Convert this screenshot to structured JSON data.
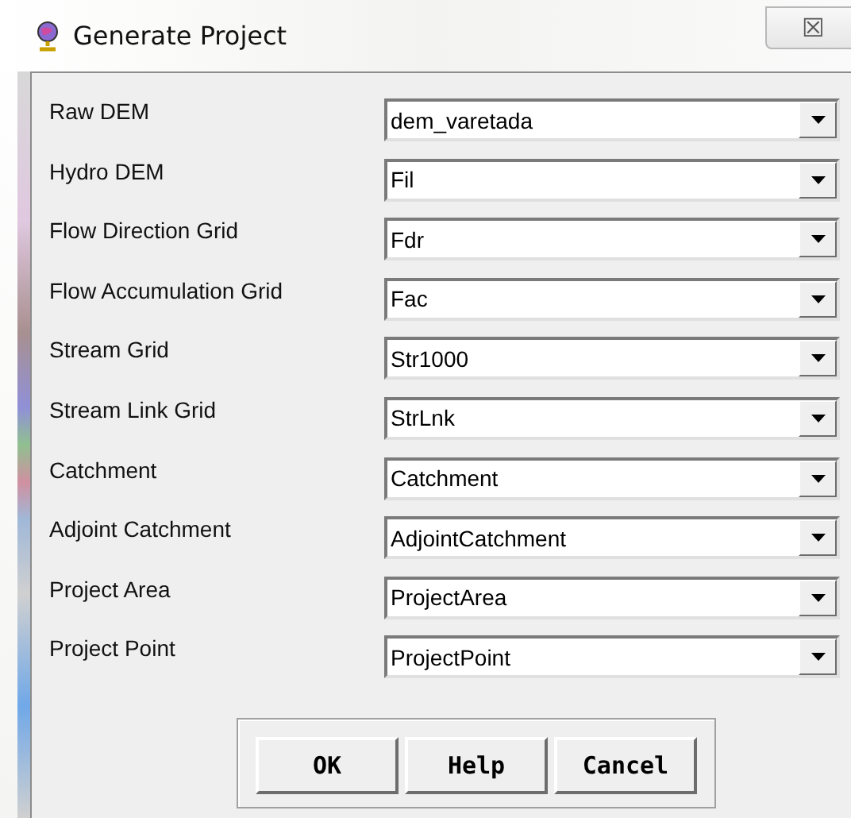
{
  "window": {
    "title": "Generate Project",
    "close": "☒"
  },
  "fields": [
    {
      "label": "Raw DEM",
      "value": "dem_varetada"
    },
    {
      "label": "Hydro DEM",
      "value": "Fil"
    },
    {
      "label": "Flow Direction Grid",
      "value": "Fdr"
    },
    {
      "label": "Flow Accumulation Grid",
      "value": "Fac"
    },
    {
      "label": "Stream Grid",
      "value": "Str1000"
    },
    {
      "label": "Stream Link Grid",
      "value": "StrLnk"
    },
    {
      "label": "Catchment",
      "value": "Catchment"
    },
    {
      "label": "Adjoint Catchment",
      "value": "AdjointCatchment"
    },
    {
      "label": "Project Area",
      "value": "ProjectArea"
    },
    {
      "label": "Project Point",
      "value": "ProjectPoint"
    }
  ],
  "buttons": [
    "OK",
    "Help",
    "Cancel"
  ]
}
